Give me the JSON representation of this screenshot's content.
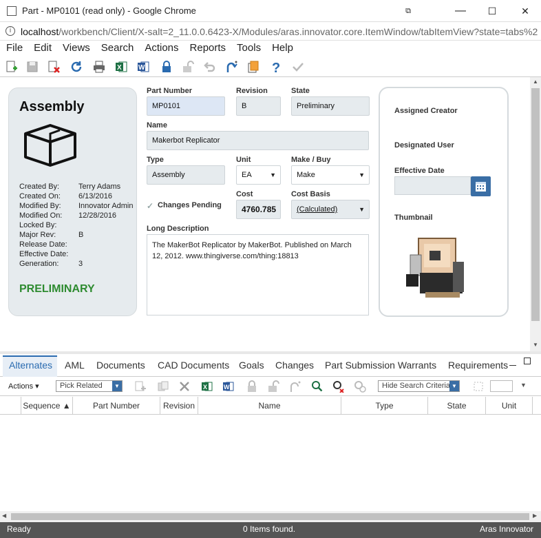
{
  "window": {
    "title": "Part - MP0101 (read only) - Google Chrome",
    "minimize": "—",
    "maximize": "☐",
    "close": "✕"
  },
  "address": {
    "url_host": "localhost",
    "url_path": "/workbench/Client/X-salt=2_11.0.0.6423-X/Modules/aras.innovator.core.ItemWindow/tabItemView?state=tabs%2"
  },
  "menu": [
    "File",
    "Edit",
    "Views",
    "Search",
    "Actions",
    "Reports",
    "Tools",
    "Help"
  ],
  "toolbar_icons": [
    "new-icon",
    "save-icon",
    "delete-icon",
    "refresh-icon",
    "print-icon",
    "excel-icon",
    "word-icon",
    "lock-icon",
    "unlock-icon",
    "undo-icon",
    "promote-icon",
    "copy-icon",
    "help-icon",
    "done-icon"
  ],
  "left_panel": {
    "heading": "Assembly",
    "meta": [
      {
        "label": "Created By:",
        "value": "Terry Adams"
      },
      {
        "label": "Created On:",
        "value": "6/13/2016"
      },
      {
        "label": "Modified By:",
        "value": "Innovator Admin"
      },
      {
        "label": "Modified On:",
        "value": "12/28/2016"
      },
      {
        "label": "Locked By:",
        "value": ""
      },
      {
        "label": "Major Rev:",
        "value": "B"
      },
      {
        "label": "Release Date:",
        "value": ""
      },
      {
        "label": "Effective Date:",
        "value": ""
      },
      {
        "label": "Generation:",
        "value": "3"
      }
    ],
    "status": "PRELIMINARY",
    "status_color": "#2e8b30"
  },
  "form": {
    "part_number_label": "Part Number",
    "part_number": "MP0101",
    "revision_label": "Revision",
    "revision": "B",
    "state_label": "State",
    "state": "Preliminary",
    "name_label": "Name",
    "name": "Makerbot Replicator",
    "type_label": "Type",
    "type": "Assembly",
    "unit_label": "Unit",
    "unit": "EA",
    "make_buy_label": "Make / Buy",
    "make_buy": "Make",
    "changes_pending_label": "Changes Pending",
    "cost_label": "Cost",
    "cost": "4760.785",
    "cost_basis_label": "Cost Basis",
    "cost_basis": "(Calculated)",
    "long_description_label": "Long Description",
    "long_description": "The MakerBot Replicator by MakerBot. Published on March 12, 2012. www.thingiverse.com/thing:18813"
  },
  "right_panel": {
    "assigned_creator_label": "Assigned Creator",
    "designated_user_label": "Designated User",
    "effective_date_label": "Effective Date",
    "thumbnail_label": "Thumbnail"
  },
  "tabs": [
    "Alternates",
    "AML",
    "Documents",
    "CAD Documents",
    "Goals",
    "Changes",
    "Part Submission Warrants",
    "Requirements"
  ],
  "grid_toolbar": {
    "actions": "Actions ▾",
    "pick_related": "Pick Related",
    "hide_search": "Hide Search Criteria"
  },
  "grid_columns": [
    "Sequence ▲",
    "Part Number",
    "Revision",
    "Name",
    "Type",
    "State",
    "Unit"
  ],
  "status": {
    "left": "Ready",
    "center": "0 Items found.",
    "right": "Aras Innovator"
  },
  "colors": {
    "accent": "#2a6bb0",
    "field_bg": "#e6ebee",
    "status_bar": "#555555"
  }
}
